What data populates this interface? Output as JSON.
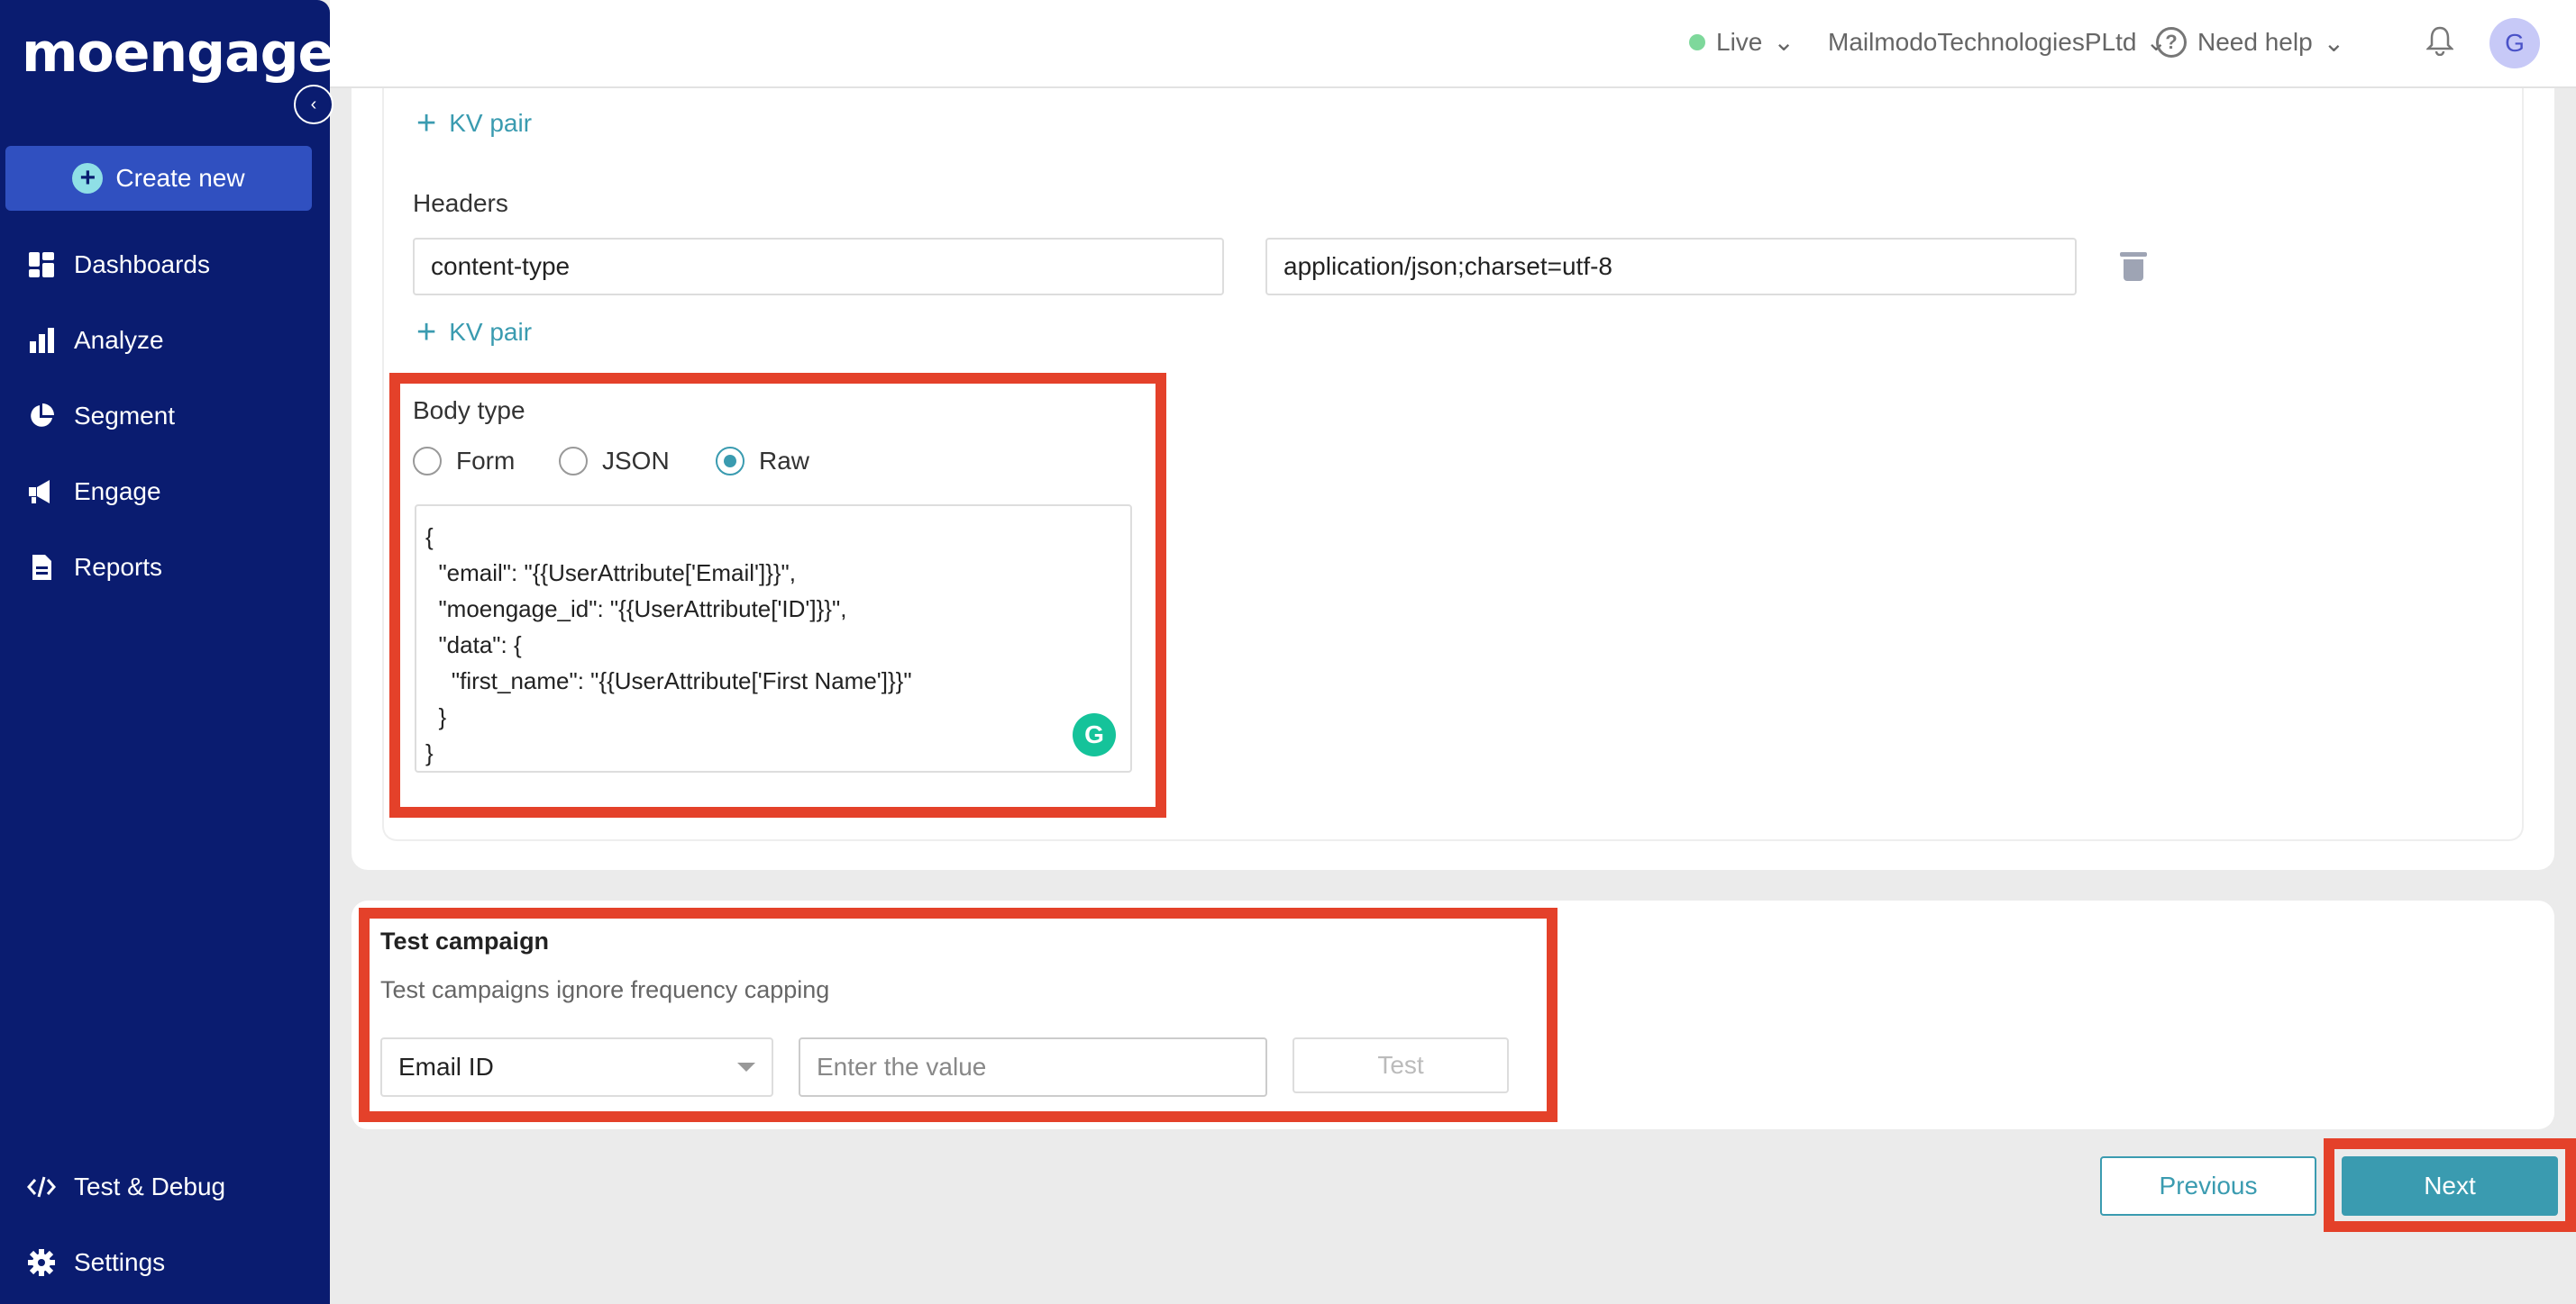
{
  "brand": {
    "logo_text": "moengage",
    "accent": "#3a9bb0",
    "sidebar_bg": "#0a1c70",
    "highlight": "#e4412a"
  },
  "sidebar": {
    "create_label": "Create new",
    "items": [
      {
        "label": "Dashboards",
        "icon": "dashboard-icon"
      },
      {
        "label": "Analyze",
        "icon": "bar-chart-icon"
      },
      {
        "label": "Segment",
        "icon": "pie-chart-icon"
      },
      {
        "label": "Engage",
        "icon": "megaphone-icon"
      },
      {
        "label": "Reports",
        "icon": "document-icon"
      }
    ],
    "bottom_items": [
      {
        "label": "Test & Debug",
        "icon": "code-icon"
      },
      {
        "label": "Settings",
        "icon": "gear-icon"
      }
    ]
  },
  "topbar": {
    "env": "Live",
    "org": "MailmodoTechnologiesPLtd",
    "help": "Need help",
    "avatar_initial": "G"
  },
  "request": {
    "kv_pair_label": "KV pair",
    "headers_label": "Headers",
    "headers": [
      {
        "key": "content-type",
        "value": "application/json;charset=utf-8"
      }
    ],
    "body_type_label": "Body type",
    "body_types": [
      "Form",
      "JSON",
      "Raw"
    ],
    "body_type_selected": "Raw",
    "body_raw": "{\n  \"email\": \"{{UserAttribute['Email']}}\",\n  \"moengage_id\": \"{{UserAttribute['ID']}}\",\n  \"data\": {\n    \"first_name\": \"{{UserAttribute['First Name']}}\"\n  }\n}"
  },
  "test_campaign": {
    "title": "Test campaign",
    "subtitle": "Test campaigns ignore frequency capping",
    "select_value": "Email ID",
    "input_placeholder": "Enter the value",
    "test_label": "Test"
  },
  "footer": {
    "previous_label": "Previous",
    "next_label": "Next"
  }
}
